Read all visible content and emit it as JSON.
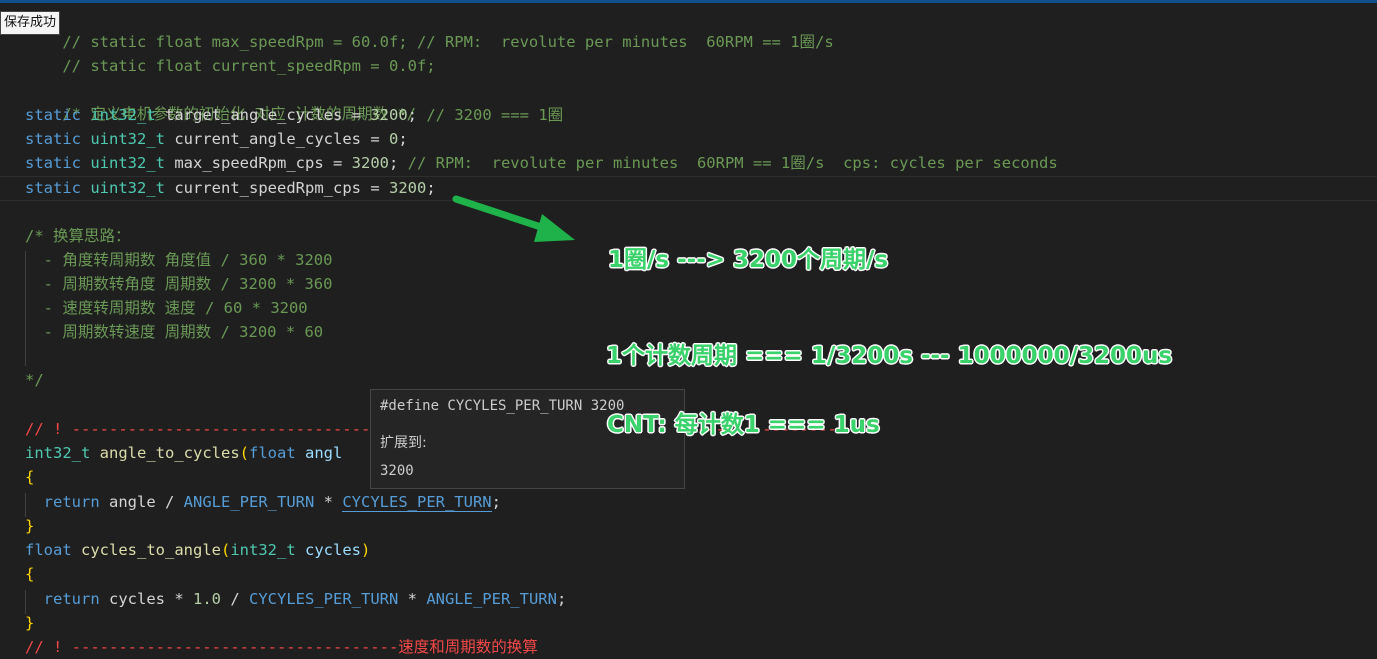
{
  "toast": {
    "text": "保存成功"
  },
  "code": {
    "l1": {
      "indent": "",
      "slashes": "//",
      "body": " static float max_speedRpm = 60.0f; // RPM:  revolute per minutes  60RPM == 1圈/s"
    },
    "l2": {
      "slashes": "//",
      "body": " static float current_speedRpm = 0.0f;"
    },
    "l4": {
      "comment": "/* 定义电机参数的初始化 对应 计数的周期数 */"
    },
    "l5": {
      "kw": "static",
      "type": "int32_t",
      "name": "target_angle_cycles",
      "eq": " = ",
      "num": "3200",
      "semi": ";",
      "comment": " // 3200 === 1圈"
    },
    "l6": {
      "kw": "static",
      "type": "uint32_t",
      "name": "current_angle_cycles",
      "eq": " = ",
      "num": "0",
      "semi": ";"
    },
    "l7": {
      "kw": "static",
      "type": "uint32_t",
      "name": "max_speedRpm_cps",
      "eq": " = ",
      "num": "3200",
      "semi": ";",
      "comment": " // RPM:  revolute per minutes  60RPM == 1圈/s  cps: cycles per seconds"
    },
    "l8": {
      "kw": "static",
      "type": "uint32_t",
      "name": "current_speedRpm_cps",
      "eq": " = ",
      "num": "3200",
      "semi": ";"
    },
    "l10": "/* 换算思路：",
    "l11": "  - 角度转周期数 角度值 / 360 * 3200",
    "l12": "  - 周期数转角度 周期数 / 3200 * 360",
    "l13": "  - 速度转周期数 速度 / 60 * 3200",
    "l14": "  - 周期数转速度 周期数 / 3200 * 60",
    "l16": "*/",
    "l18": "// ! -----------------------------------------------------------------------------------",
    "l19": {
      "type": "int32_t",
      "fn": "angle_to_cycles",
      "open": "(",
      "ptype": "float",
      "param": " angl"
    },
    "l20": "{",
    "l21": {
      "kw": "return",
      "a": " angle / ",
      "m1": "ANGLE_PER_TURN",
      "op": " * ",
      "m2": "CYCYLES_PER_TURN",
      "semi": ";"
    },
    "l22": "}",
    "l23": {
      "type": "float",
      "fn": "cycles_to_angle",
      "open": "(",
      "ptype": "int32_t",
      "param": " cycles",
      "close": ")"
    },
    "l24": "{",
    "l25": {
      "kw": "return",
      "a": " cycles * ",
      "num": "1.0",
      "b": " / ",
      "m1": "CYCYLES_PER_TURN",
      "op": " * ",
      "m2": "ANGLE_PER_TURN",
      "semi": ";"
    },
    "l26": "}",
    "l27": {
      "left": "// ! -----------------------------------",
      "right": "速度和周期数的换算"
    }
  },
  "hover": {
    "define": "#define CYCYLES_PER_TURN 3200",
    "expands_label": "扩展到:",
    "value": "3200"
  },
  "notes": {
    "n1": "1圈/s ---> 3200个周期/s",
    "n2": "1个计数周期 === 1/3200s  --- 1000000/3200us",
    "n3": "CNT: 每计数1 === 1us"
  },
  "colors": {
    "note_green": "#3ad26a",
    "arrow_green": "#1fb24a",
    "editor_bg": "#1f1f1f"
  }
}
